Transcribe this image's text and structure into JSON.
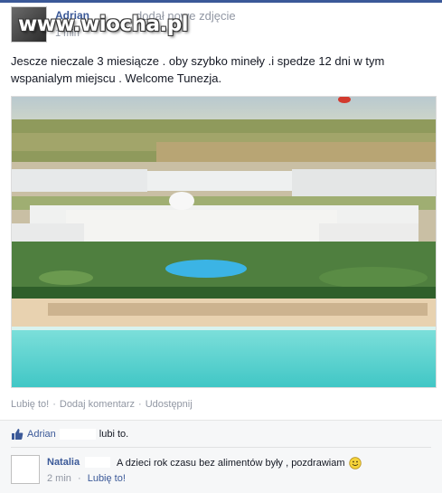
{
  "post": {
    "author": "Adrian",
    "action": "dodał nowe zdjęcie",
    "time": "1 min",
    "watermark": "www.wiocha.pl",
    "text": "Jescze nieczale 3 miesiącze . oby szybko mineły .i spedze 12 dni w tym wspanialym miejscu . Welcome Tunezja."
  },
  "actions": {
    "like": "Lubię to!",
    "comment": "Dodaj komentarz",
    "share": "Udostępnij",
    "separator": "·"
  },
  "likes": {
    "name": "Adrian",
    "suffix": "lubi to."
  },
  "comment": {
    "author": "Natalia",
    "text": "A dzieci rok czasu bez alimentów były , pozdrawiam",
    "time": "2 min",
    "separator": "·",
    "like": "Lubię to!"
  },
  "colors": {
    "accent": "#3b5998",
    "meta": "#9197a3",
    "sea": "#5fd3d0"
  }
}
